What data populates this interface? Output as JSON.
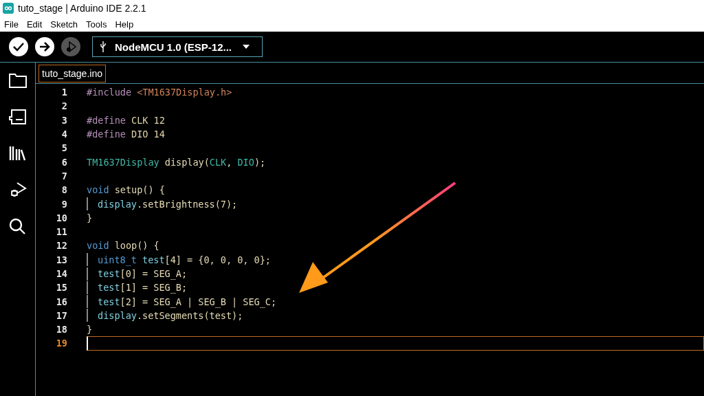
{
  "window": {
    "title": "tuto_stage | Arduino IDE 2.2.1"
  },
  "menu": [
    "File",
    "Edit",
    "Sketch",
    "Tools",
    "Help"
  ],
  "toolbar": {
    "buttons": [
      {
        "kind": "verify",
        "disabled": false
      },
      {
        "kind": "upload",
        "disabled": false
      },
      {
        "kind": "debug",
        "disabled": true
      }
    ],
    "board": "NodeMCU 1.0 (ESP-12..."
  },
  "sidebar": {
    "items": [
      {
        "kind": "folder"
      },
      {
        "kind": "board"
      },
      {
        "kind": "library"
      },
      {
        "kind": "debug"
      },
      {
        "kind": "search"
      }
    ]
  },
  "tabs": [
    {
      "label": "tuto_stage.ino",
      "selected": true
    }
  ],
  "code": [
    {
      "number": "1",
      "indent": false,
      "current": false,
      "tokens": [
        {
          "kind": "preproc",
          "text": "#include"
        },
        {
          "kind": "path",
          "text": " <TM1637Display.h>"
        }
      ]
    },
    {
      "number": "2",
      "indent": false,
      "current": false
    },
    {
      "number": "3",
      "indent": false,
      "current": false,
      "tokens": [
        {
          "kind": "preproc",
          "text": "#define"
        },
        {
          "kind": "macro",
          "text": " CLK 12"
        }
      ]
    },
    {
      "number": "4",
      "indent": false,
      "current": false,
      "tokens": [
        {
          "kind": "preproc",
          "text": "#define"
        },
        {
          "kind": "macro",
          "text": " DIO 14"
        }
      ]
    },
    {
      "number": "5",
      "indent": false,
      "current": false
    },
    {
      "number": "6",
      "indent": false,
      "current": false,
      "tokens": [
        {
          "kind": "type",
          "text": "TM1637Display"
        },
        {
          "kind": "plain",
          "text": " display("
        },
        {
          "kind": "type",
          "text": "CLK"
        },
        {
          "kind": "plain",
          "text": ", "
        },
        {
          "kind": "type",
          "text": "DIO"
        },
        {
          "kind": "plain",
          "text": ");"
        }
      ]
    },
    {
      "number": "7",
      "indent": false,
      "current": false
    },
    {
      "number": "8",
      "indent": false,
      "current": false,
      "tokens": [
        {
          "kind": "keyword",
          "text": "void"
        },
        {
          "kind": "plain",
          "text": " setup() {"
        }
      ]
    },
    {
      "number": "9",
      "indent": true,
      "current": false,
      "tokens": [
        {
          "kind": "object",
          "text": "display"
        },
        {
          "kind": "plain",
          "text": ".setBrightness(7);"
        }
      ]
    },
    {
      "number": "10",
      "indent": false,
      "current": false,
      "tokens": [
        {
          "kind": "plain",
          "text": "}"
        }
      ]
    },
    {
      "number": "11",
      "indent": false,
      "current": false
    },
    {
      "number": "12",
      "indent": false,
      "current": false,
      "tokens": [
        {
          "kind": "keyword",
          "text": "void"
        },
        {
          "kind": "plain",
          "text": " loop() {"
        }
      ]
    },
    {
      "number": "13",
      "indent": true,
      "current": false,
      "tokens": [
        {
          "kind": "keyword",
          "text": "uint8_t"
        },
        {
          "kind": "object",
          "text": " test"
        },
        {
          "kind": "plain",
          "text": "[4] = {0, 0, 0, 0};"
        }
      ]
    },
    {
      "number": "14",
      "indent": true,
      "current": false,
      "tokens": [
        {
          "kind": "object",
          "text": "test"
        },
        {
          "kind": "plain",
          "text": "[0] = SEG_A;"
        }
      ]
    },
    {
      "number": "15",
      "indent": true,
      "current": false,
      "tokens": [
        {
          "kind": "object",
          "text": "test"
        },
        {
          "kind": "plain",
          "text": "[1] = SEG_B;"
        }
      ]
    },
    {
      "number": "16",
      "indent": true,
      "current": false,
      "tokens": [
        {
          "kind": "object",
          "text": "test"
        },
        {
          "kind": "plain",
          "text": "[2] = SEG_A | SEG_B | SEG_C;"
        }
      ]
    },
    {
      "number": "17",
      "indent": true,
      "current": false,
      "tokens": [
        {
          "kind": "object",
          "text": "display"
        },
        {
          "kind": "plain",
          "text": ".setSegments(test);"
        }
      ]
    },
    {
      "number": "18",
      "indent": false,
      "current": false,
      "tokens": [
        {
          "kind": "plain",
          "text": "}"
        }
      ]
    },
    {
      "number": "19",
      "indent": false,
      "current": true
    }
  ]
}
